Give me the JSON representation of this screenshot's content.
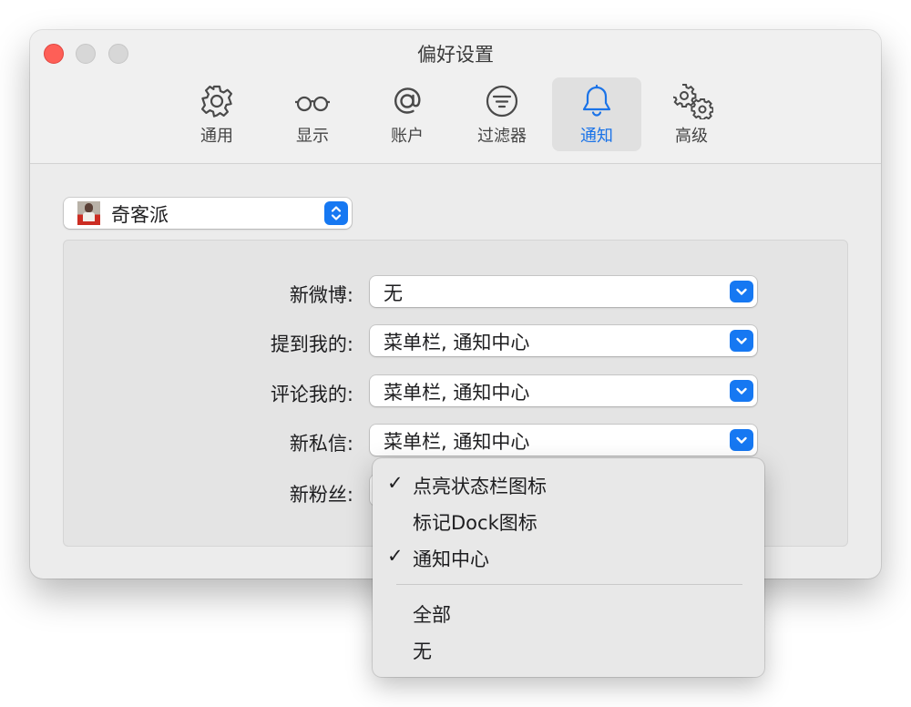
{
  "window": {
    "title": "偏好设置"
  },
  "toolbar": {
    "tabs": [
      {
        "label": "通用",
        "icon": "gear-icon",
        "active": false
      },
      {
        "label": "显示",
        "icon": "glasses-icon",
        "active": false
      },
      {
        "label": "账户",
        "icon": "at-icon",
        "active": false
      },
      {
        "label": "过滤器",
        "icon": "filter-icon",
        "active": false
      },
      {
        "label": "通知",
        "icon": "bell-icon",
        "active": true
      },
      {
        "label": "高级",
        "icon": "gears-icon",
        "active": false
      }
    ]
  },
  "account": {
    "name": "奇客派"
  },
  "notifications": {
    "rows": [
      {
        "label": "新微博:",
        "value": "无"
      },
      {
        "label": "提到我的:",
        "value": "菜单栏, 通知中心"
      },
      {
        "label": "评论我的:",
        "value": "菜单栏, 通知中心"
      },
      {
        "label": "新私信:",
        "value": "菜单栏, 通知中心"
      },
      {
        "label": "新粉丝:",
        "value": ""
      }
    ]
  },
  "menu": {
    "items": [
      {
        "label": "点亮状态栏图标",
        "checked": true
      },
      {
        "label": "标记Dock图标",
        "checked": false
      },
      {
        "label": "通知中心",
        "checked": true
      },
      {
        "label": "全部",
        "checked": false
      },
      {
        "label": "无",
        "checked": false
      }
    ],
    "check_glyph": "✓"
  },
  "colors": {
    "accent": "#1678f2",
    "close": "#fe5f57"
  }
}
